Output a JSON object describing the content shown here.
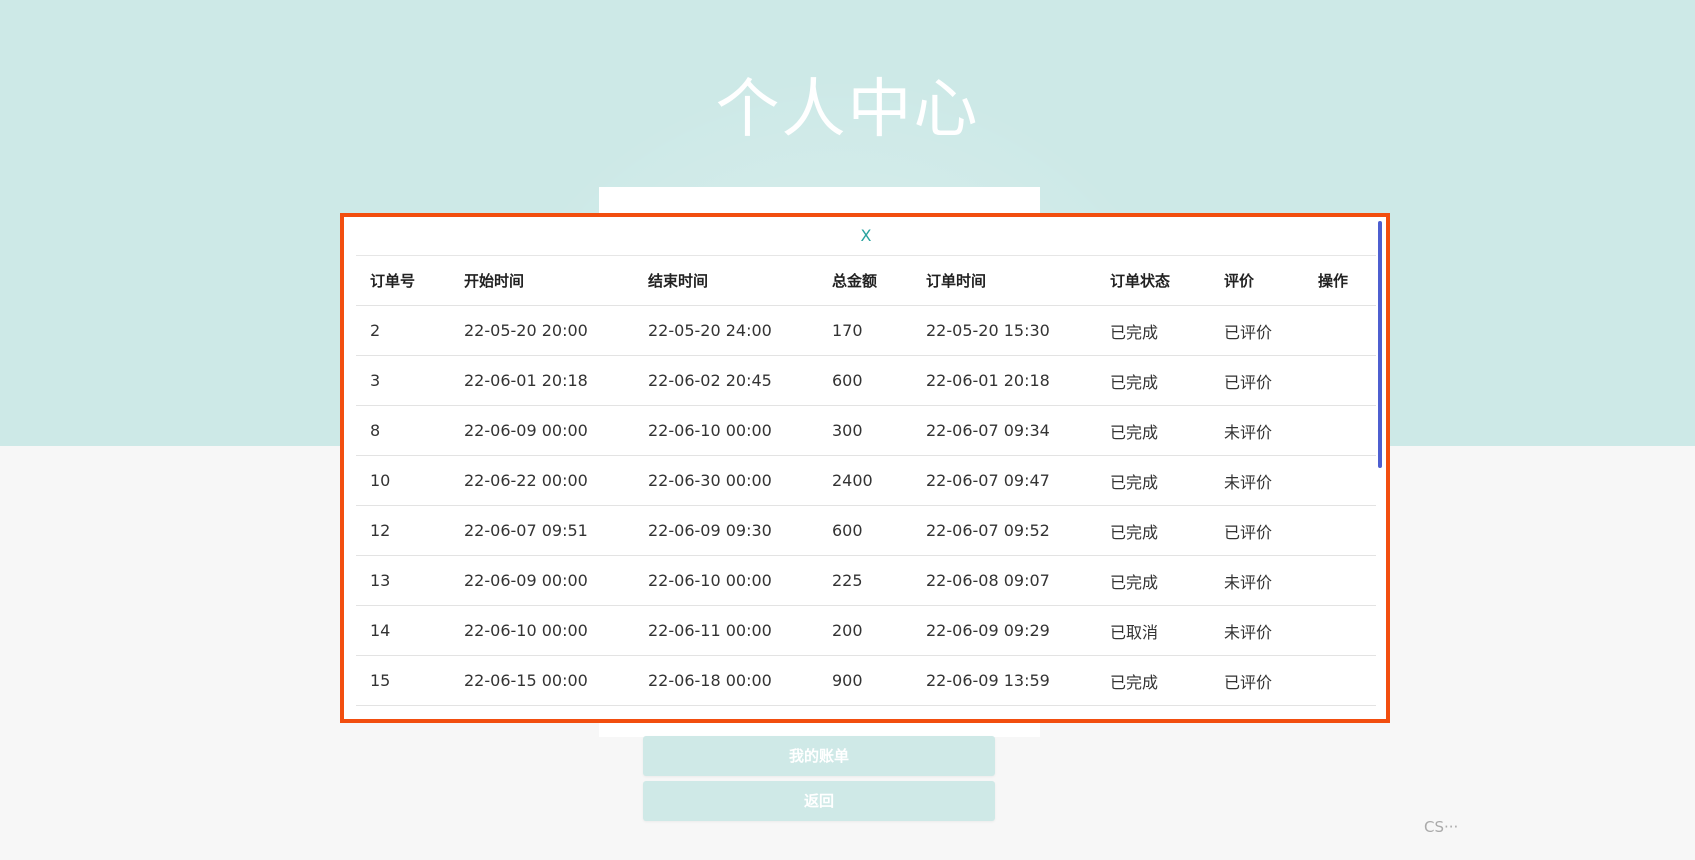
{
  "page": {
    "title": "个人中心"
  },
  "buttons": {
    "bill": "我的账单",
    "back": "返回"
  },
  "modal": {
    "close_label": "X",
    "columns": [
      "订单号",
      "开始时间",
      "结束时间",
      "总金额",
      "订单时间",
      "订单状态",
      "评价",
      "操作"
    ],
    "rows": [
      [
        "2",
        "22-05-20 20:00",
        "22-05-20 24:00",
        "170",
        "22-05-20 15:30",
        "已完成",
        "已评价",
        ""
      ],
      [
        "3",
        "22-06-01 20:18",
        "22-06-02 20:45",
        "600",
        "22-06-01 20:18",
        "已完成",
        "已评价",
        ""
      ],
      [
        "8",
        "22-06-09 00:00",
        "22-06-10 00:00",
        "300",
        "22-06-07 09:34",
        "已完成",
        "未评价",
        ""
      ],
      [
        "10",
        "22-06-22 00:00",
        "22-06-30 00:00",
        "2400",
        "22-06-07 09:47",
        "已完成",
        "未评价",
        ""
      ],
      [
        "12",
        "22-06-07 09:51",
        "22-06-09 09:30",
        "600",
        "22-06-07 09:52",
        "已完成",
        "已评价",
        ""
      ],
      [
        "13",
        "22-06-09 00:00",
        "22-06-10 00:00",
        "225",
        "22-06-08 09:07",
        "已完成",
        "未评价",
        ""
      ],
      [
        "14",
        "22-06-10 00:00",
        "22-06-11 00:00",
        "200",
        "22-06-09 09:29",
        "已取消",
        "未评价",
        ""
      ],
      [
        "15",
        "22-06-15 00:00",
        "22-06-18 00:00",
        "900",
        "22-06-09 13:59",
        "已完成",
        "已评价",
        ""
      ]
    ]
  },
  "watermark": "CS···",
  "colors": {
    "top_band": "#cde9e7",
    "modal_border": "#f24e0f",
    "close_x": "#2aa3a0",
    "scrollbar": "#4d5fd0"
  }
}
